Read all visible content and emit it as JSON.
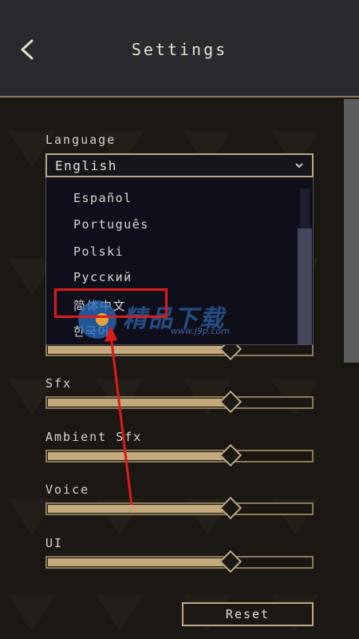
{
  "header": {
    "title": "Settings",
    "back_icon": "chevron-left-icon"
  },
  "language": {
    "label": "Language",
    "selected": "English",
    "options": [
      "Español",
      "Português",
      "Polski",
      "Русский",
      "简体中文",
      "한국어"
    ],
    "highlighted_option": "简体中文"
  },
  "sliders": [
    {
      "label": "",
      "value": 0.7
    },
    {
      "label": "Sfx",
      "value": 0.7
    },
    {
      "label": "Ambient Sfx",
      "value": 0.7
    },
    {
      "label": "Voice",
      "value": 0.7
    },
    {
      "label": "UI",
      "value": 0.7
    }
  ],
  "reset_label": "Reset",
  "watermark": {
    "text": "精品下载",
    "url": "www.j9p.com"
  },
  "colors": {
    "accent": "#bda987",
    "slider_fill": "#c4a97c",
    "highlight": "#e01a1a",
    "header_bg": "#2a2a2e"
  }
}
